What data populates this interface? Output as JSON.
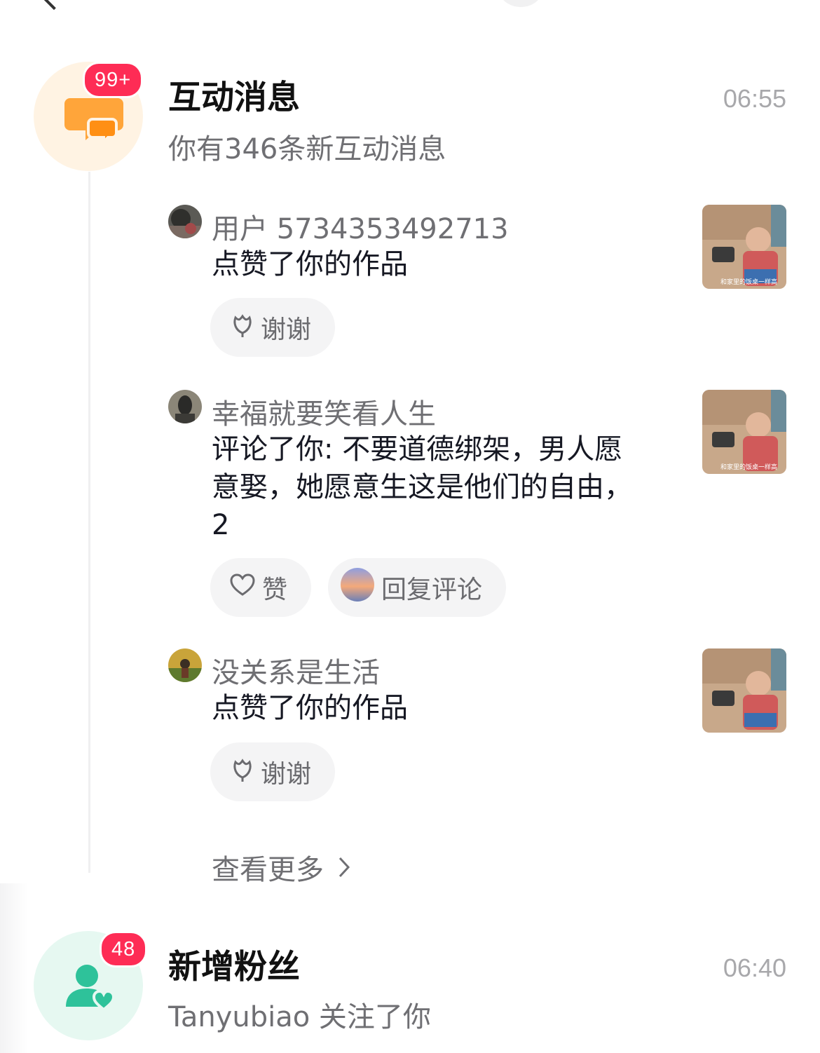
{
  "interactions": {
    "badge": "99+",
    "title": "互动消息",
    "time": "06:55",
    "subtitle": "你有346条新互动消息",
    "see_more": "查看更多",
    "items": [
      {
        "user": "用户 5734353492713",
        "text": "点赞了你的作品",
        "actions": [
          "谢谢"
        ]
      },
      {
        "user": "幸福就要笑看人生",
        "text_lines": [
          "评论了你: 不要道德绑架，男人愿",
          "意娶，她愿意生这是他们的自由，",
          "2"
        ],
        "actions": [
          "赞",
          "回复评论"
        ]
      },
      {
        "user": "没关系是生活",
        "text": "点赞了你的作品",
        "actions": [
          "谢谢"
        ]
      }
    ],
    "thumb_caption": "和家里的饭桌一样高",
    "icon": "chat-bubbles-icon",
    "accent_color": "#ff9f2e"
  },
  "followers": {
    "badge": "48",
    "title": "新增粉丝",
    "time": "06:40",
    "subtitle": "Tanyubiao 关注了你",
    "icon": "user-heart-icon",
    "accent_color": "#2ec29a"
  }
}
